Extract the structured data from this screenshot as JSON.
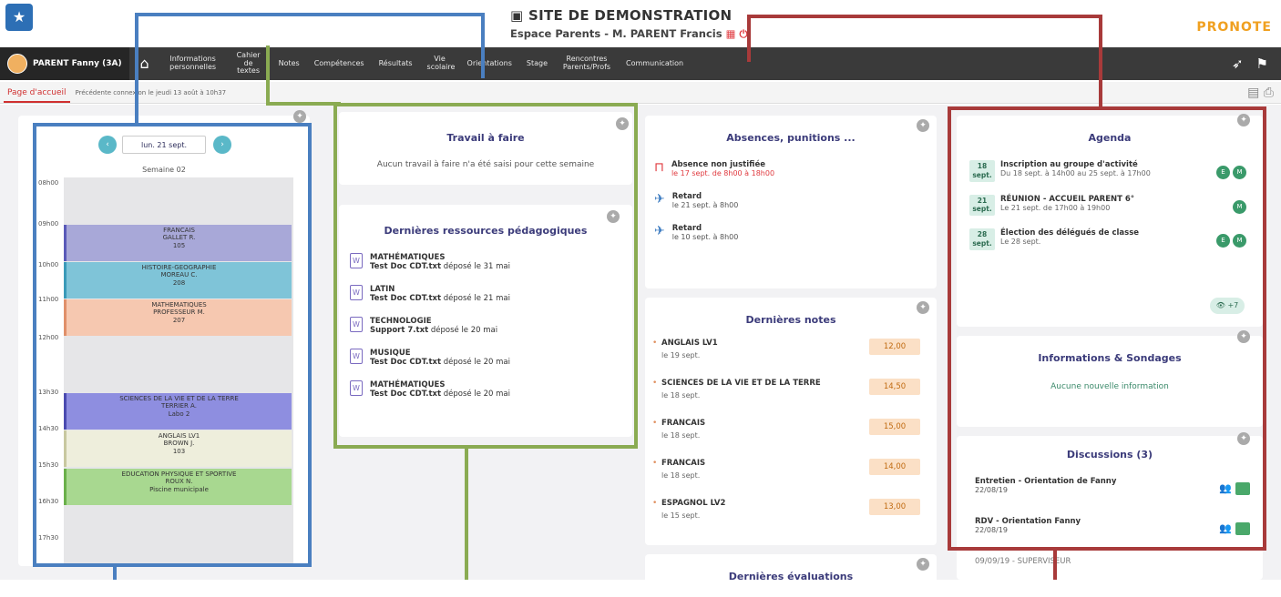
{
  "header": {
    "site_title": "SITE DE DEMONSTRATION",
    "space_title": "Espace Parents - M. PARENT Francis",
    "brand": "PRONOTE"
  },
  "nav": {
    "user": "PARENT Fanny (3A)",
    "items": [
      "Informations personnelles",
      "Cahier de textes",
      "Notes",
      "Compétences",
      "Résultats",
      "Vie scolaire",
      "Orientations",
      "Stage",
      "Rencontres Parents/Profs",
      "Communication"
    ]
  },
  "breadcrumb": {
    "home": "Page d'accueil",
    "last_connection": "Précédente connexion le jeudi 13 août à 10h37"
  },
  "schedule": {
    "date": "lun. 21 sept.",
    "week": "Semaine 02",
    "hours": [
      "08h00",
      "09h00",
      "10h00",
      "11h00",
      "12h00",
      "13h30",
      "14h30",
      "15h30",
      "16h30",
      "17h30"
    ],
    "courses": [
      {
        "name": "FRANCAIS",
        "teacher": "GALLET R.",
        "room": "105",
        "color": "#a8a8d8",
        "border": "#5a5ab8"
      },
      {
        "name": "HISTOIRE-GEOGRAPHIE",
        "teacher": "MOREAU C.",
        "room": "208",
        "color": "#7fc4d8",
        "border": "#3a9ab8"
      },
      {
        "name": "MATHEMATIQUES",
        "teacher": "PROFESSEUR M.",
        "room": "207",
        "color": "#f6c8b0",
        "border": "#e0906a"
      },
      {
        "name": "SCIENCES DE LA VIE ET DE LA TERRE",
        "teacher": "TERRIER A.",
        "room": "Labo 2",
        "color": "#8e8ee0",
        "border": "#4a4ab0"
      },
      {
        "name": "ANGLAIS LV1",
        "teacher": "BROWN J.",
        "room": "103",
        "color": "#eeeedc",
        "border": "#c8c8a0"
      },
      {
        "name": "EDUCATION PHYSIQUE ET SPORTIVE",
        "teacher": "ROUX N.",
        "room": "Piscine municipale",
        "color": "#a8d890",
        "border": "#6ab04a"
      }
    ]
  },
  "travail": {
    "title": "Travail à faire",
    "empty": "Aucun travail à faire n'a été saisi pour cette semaine"
  },
  "ressources": {
    "title": "Dernières ressources pédagogiques",
    "items": [
      {
        "subject": "MATHÉMATIQUES",
        "file": "Test Doc CDT.txt",
        "info": "déposé le 31 mai"
      },
      {
        "subject": "LATIN",
        "file": "Test Doc CDT.txt",
        "info": "déposé le 21 mai"
      },
      {
        "subject": "TECHNOLOGIE",
        "file": "Support 7.txt",
        "info": "déposé le 20 mai"
      },
      {
        "subject": "MUSIQUE",
        "file": "Test Doc CDT.txt",
        "info": "déposé le 20 mai"
      },
      {
        "subject": "MATHÉMATIQUES",
        "file": "Test Doc CDT.txt",
        "info": "déposé le 20 mai"
      }
    ]
  },
  "absences": {
    "title": "Absences, punitions ...",
    "items": [
      {
        "label": "Absence non justifiée",
        "detail": "le 17 sept. de 8h00 à 18h00",
        "red": true
      },
      {
        "label": "Retard",
        "detail": "le 21 sept. à 8h00",
        "red": false
      },
      {
        "label": "Retard",
        "detail": "le 10 sept. à 8h00",
        "red": false
      }
    ]
  },
  "notes": {
    "title": "Dernières notes",
    "items": [
      {
        "subject": "ANGLAIS LV1",
        "date": "le 19 sept.",
        "value": "12,00"
      },
      {
        "subject": "SCIENCES DE LA VIE ET DE LA TERRE",
        "date": "le 18 sept.",
        "value": "14,50"
      },
      {
        "subject": "FRANCAIS",
        "date": "le 18 sept.",
        "value": "15,00"
      },
      {
        "subject": "FRANCAIS",
        "date": "le 18 sept.",
        "value": "14,00"
      },
      {
        "subject": "ESPAGNOL LV2",
        "date": "le 15 sept.",
        "value": "13,00"
      }
    ]
  },
  "evaluations": {
    "title": "Dernières évaluations"
  },
  "agenda": {
    "title": "Agenda",
    "items": [
      {
        "day": "18",
        "month": "sept.",
        "title": "Inscription au groupe d'activité",
        "detail": "Du 18 sept. à 14h00 au 25 sept. à 17h00",
        "dots": [
          "E",
          "M"
        ]
      },
      {
        "day": "21",
        "month": "sept.",
        "title": "RÉUNION - ACCUEIL PARENT 6°",
        "detail": "Le 21 sept. de 17h00 à 19h00",
        "dots": [
          "M"
        ]
      },
      {
        "day": "28",
        "month": "sept.",
        "title": "Élection des délégués de classe",
        "detail": "Le 28 sept.",
        "dots": [
          "E",
          "M"
        ]
      }
    ],
    "more": "+7"
  },
  "infos": {
    "title": "Informations & Sondages",
    "empty": "Aucune nouvelle information"
  },
  "discussions": {
    "title": "Discussions (3)",
    "items": [
      {
        "title": "Entretien - Orientation de Fanny",
        "date": "22/08/19"
      },
      {
        "title": "RDV - Orientation Fanny",
        "date": "22/08/19"
      },
      {
        "title": "09/09/19 - SUPERVISEUR",
        "date": ""
      }
    ]
  },
  "colors": {
    "blue_frame": "#4a7fc0",
    "green_frame": "#8aab52",
    "red_frame": "#a83a3a"
  }
}
